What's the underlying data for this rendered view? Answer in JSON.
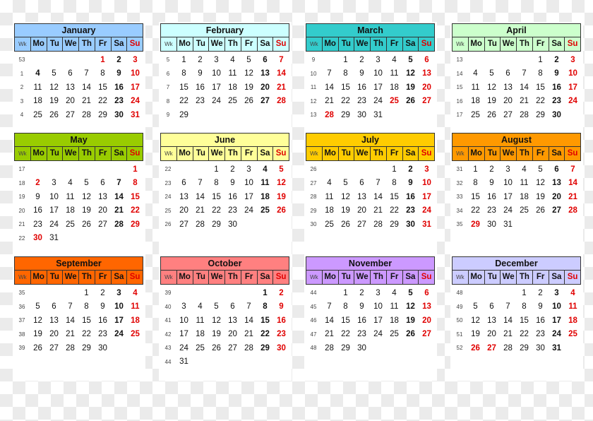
{
  "colors": {
    "holiday_red": "#e00000",
    "January": "#99ccff",
    "February": "#ccffff",
    "March": "#33cccc",
    "April": "#ccffcc",
    "May": "#99cc00",
    "June": "#ffff99",
    "July": "#ffcc00",
    "August": "#ff9900",
    "September": "#ff6600",
    "October": "#ff8080",
    "November": "#cc99ff",
    "December": "#ccccff"
  },
  "header_labels": [
    "Wk",
    "Mo",
    "Tu",
    "We",
    "Th",
    "Fr",
    "Sa",
    "Su"
  ],
  "months": [
    {
      "name": "January",
      "color_key": "January",
      "weeks": [
        {
          "wk": "53",
          "days": [
            "",
            "",
            "",
            "",
            "1",
            "2",
            "3"
          ]
        },
        {
          "wk": "1",
          "days": [
            "4",
            "5",
            "6",
            "7",
            "8",
            "9",
            "10"
          ]
        },
        {
          "wk": "2",
          "days": [
            "11",
            "12",
            "13",
            "14",
            "15",
            "16",
            "17"
          ]
        },
        {
          "wk": "3",
          "days": [
            "18",
            "19",
            "20",
            "21",
            "22",
            "23",
            "24"
          ]
        },
        {
          "wk": "4",
          "days": [
            "25",
            "26",
            "27",
            "28",
            "29",
            "30",
            "31"
          ]
        }
      ],
      "holidays": [
        "1"
      ],
      "bold_extra": [
        "4"
      ]
    },
    {
      "name": "February",
      "color_key": "February",
      "weeks": [
        {
          "wk": "5",
          "days": [
            "1",
            "2",
            "3",
            "4",
            "5",
            "6",
            "7"
          ]
        },
        {
          "wk": "6",
          "days": [
            "8",
            "9",
            "10",
            "11",
            "12",
            "13",
            "14"
          ]
        },
        {
          "wk": "7",
          "days": [
            "15",
            "16",
            "17",
            "18",
            "19",
            "20",
            "21"
          ]
        },
        {
          "wk": "8",
          "days": [
            "22",
            "23",
            "24",
            "25",
            "26",
            "27",
            "28"
          ]
        },
        {
          "wk": "9",
          "days": [
            "29",
            "",
            "",
            "",
            "",
            "",
            ""
          ]
        }
      ],
      "holidays": [],
      "bold_extra": []
    },
    {
      "name": "March",
      "color_key": "March",
      "weeks": [
        {
          "wk": "9",
          "days": [
            "",
            "1",
            "2",
            "3",
            "4",
            "5",
            "6"
          ]
        },
        {
          "wk": "10",
          "days": [
            "7",
            "8",
            "9",
            "10",
            "11",
            "12",
            "13"
          ]
        },
        {
          "wk": "11",
          "days": [
            "14",
            "15",
            "16",
            "17",
            "18",
            "19",
            "20"
          ]
        },
        {
          "wk": "12",
          "days": [
            "21",
            "22",
            "23",
            "24",
            "25",
            "26",
            "27"
          ]
        },
        {
          "wk": "13",
          "days": [
            "28",
            "29",
            "30",
            "31",
            "",
            "",
            ""
          ]
        }
      ],
      "holidays": [
        "25",
        "28"
      ],
      "bold_extra": []
    },
    {
      "name": "April",
      "color_key": "April",
      "weeks": [
        {
          "wk": "13",
          "days": [
            "",
            "",
            "",
            "",
            "1",
            "2",
            "3"
          ]
        },
        {
          "wk": "14",
          "days": [
            "4",
            "5",
            "6",
            "7",
            "8",
            "9",
            "10"
          ]
        },
        {
          "wk": "15",
          "days": [
            "11",
            "12",
            "13",
            "14",
            "15",
            "16",
            "17"
          ]
        },
        {
          "wk": "16",
          "days": [
            "18",
            "19",
            "20",
            "21",
            "22",
            "23",
            "24"
          ]
        },
        {
          "wk": "17",
          "days": [
            "25",
            "26",
            "27",
            "28",
            "29",
            "30",
            ""
          ]
        }
      ],
      "holidays": [],
      "bold_extra": []
    },
    {
      "name": "May",
      "color_key": "May",
      "weeks": [
        {
          "wk": "17",
          "days": [
            "",
            "",
            "",
            "",
            "",
            "",
            "1"
          ]
        },
        {
          "wk": "18",
          "days": [
            "2",
            "3",
            "4",
            "5",
            "6",
            "7",
            "8"
          ]
        },
        {
          "wk": "19",
          "days": [
            "9",
            "10",
            "11",
            "12",
            "13",
            "14",
            "15"
          ]
        },
        {
          "wk": "20",
          "days": [
            "16",
            "17",
            "18",
            "19",
            "20",
            "21",
            "22"
          ]
        },
        {
          "wk": "21",
          "days": [
            "23",
            "24",
            "25",
            "26",
            "27",
            "28",
            "29"
          ]
        },
        {
          "wk": "22",
          "days": [
            "30",
            "31",
            "",
            "",
            "",
            "",
            ""
          ]
        }
      ],
      "holidays": [
        "2",
        "30"
      ],
      "bold_extra": []
    },
    {
      "name": "June",
      "color_key": "June",
      "weeks": [
        {
          "wk": "22",
          "days": [
            "",
            "",
            "1",
            "2",
            "3",
            "4",
            "5"
          ]
        },
        {
          "wk": "23",
          "days": [
            "6",
            "7",
            "8",
            "9",
            "10",
            "11",
            "12"
          ]
        },
        {
          "wk": "24",
          "days": [
            "13",
            "14",
            "15",
            "16",
            "17",
            "18",
            "19"
          ]
        },
        {
          "wk": "25",
          "days": [
            "20",
            "21",
            "22",
            "23",
            "24",
            "25",
            "26"
          ]
        },
        {
          "wk": "26",
          "days": [
            "27",
            "28",
            "29",
            "30",
            "",
            "",
            ""
          ]
        }
      ],
      "holidays": [],
      "bold_extra": []
    },
    {
      "name": "July",
      "color_key": "July",
      "weeks": [
        {
          "wk": "26",
          "days": [
            "",
            "",
            "",
            "",
            "1",
            "2",
            "3"
          ]
        },
        {
          "wk": "27",
          "days": [
            "4",
            "5",
            "6",
            "7",
            "8",
            "9",
            "10"
          ]
        },
        {
          "wk": "28",
          "days": [
            "11",
            "12",
            "13",
            "14",
            "15",
            "16",
            "17"
          ]
        },
        {
          "wk": "29",
          "days": [
            "18",
            "19",
            "20",
            "21",
            "22",
            "23",
            "24"
          ]
        },
        {
          "wk": "30",
          "days": [
            "25",
            "26",
            "27",
            "28",
            "29",
            "30",
            "31"
          ]
        }
      ],
      "holidays": [],
      "bold_extra": []
    },
    {
      "name": "August",
      "color_key": "August",
      "weeks": [
        {
          "wk": "31",
          "days": [
            "1",
            "2",
            "3",
            "4",
            "5",
            "6",
            "7"
          ]
        },
        {
          "wk": "32",
          "days": [
            "8",
            "9",
            "10",
            "11",
            "12",
            "13",
            "14"
          ]
        },
        {
          "wk": "33",
          "days": [
            "15",
            "16",
            "17",
            "18",
            "19",
            "20",
            "21"
          ]
        },
        {
          "wk": "34",
          "days": [
            "22",
            "23",
            "24",
            "25",
            "26",
            "27",
            "28"
          ]
        },
        {
          "wk": "35",
          "days": [
            "29",
            "30",
            "31",
            "",
            "",
            "",
            ""
          ]
        }
      ],
      "holidays": [
        "29"
      ],
      "bold_extra": []
    },
    {
      "name": "September",
      "color_key": "September",
      "weeks": [
        {
          "wk": "35",
          "days": [
            "",
            "",
            "",
            "1",
            "2",
            "3",
            "4"
          ]
        },
        {
          "wk": "36",
          "days": [
            "5",
            "6",
            "7",
            "8",
            "9",
            "10",
            "11"
          ]
        },
        {
          "wk": "37",
          "days": [
            "12",
            "13",
            "14",
            "15",
            "16",
            "17",
            "18"
          ]
        },
        {
          "wk": "38",
          "days": [
            "19",
            "20",
            "21",
            "22",
            "23",
            "24",
            "25"
          ]
        },
        {
          "wk": "39",
          "days": [
            "26",
            "27",
            "28",
            "29",
            "30",
            "",
            ""
          ]
        }
      ],
      "holidays": [],
      "bold_extra": []
    },
    {
      "name": "October",
      "color_key": "October",
      "weeks": [
        {
          "wk": "39",
          "days": [
            "",
            "",
            "",
            "",
            "",
            "1",
            "2"
          ]
        },
        {
          "wk": "40",
          "days": [
            "3",
            "4",
            "5",
            "6",
            "7",
            "8",
            "9"
          ]
        },
        {
          "wk": "41",
          "days": [
            "10",
            "11",
            "12",
            "13",
            "14",
            "15",
            "16"
          ]
        },
        {
          "wk": "42",
          "days": [
            "17",
            "18",
            "19",
            "20",
            "21",
            "22",
            "23"
          ]
        },
        {
          "wk": "43",
          "days": [
            "24",
            "25",
            "26",
            "27",
            "28",
            "29",
            "30"
          ]
        },
        {
          "wk": "44",
          "days": [
            "31",
            "",
            "",
            "",
            "",
            "",
            ""
          ]
        }
      ],
      "holidays": [],
      "bold_extra": []
    },
    {
      "name": "November",
      "color_key": "November",
      "weeks": [
        {
          "wk": "44",
          "days": [
            "",
            "1",
            "2",
            "3",
            "4",
            "5",
            "6"
          ]
        },
        {
          "wk": "45",
          "days": [
            "7",
            "8",
            "9",
            "10",
            "11",
            "12",
            "13"
          ]
        },
        {
          "wk": "46",
          "days": [
            "14",
            "15",
            "16",
            "17",
            "18",
            "19",
            "20"
          ]
        },
        {
          "wk": "47",
          "days": [
            "21",
            "22",
            "23",
            "24",
            "25",
            "26",
            "27"
          ]
        },
        {
          "wk": "48",
          "days": [
            "28",
            "29",
            "30",
            "",
            "",
            "",
            ""
          ]
        }
      ],
      "holidays": [],
      "bold_extra": []
    },
    {
      "name": "December",
      "color_key": "December",
      "weeks": [
        {
          "wk": "48",
          "days": [
            "",
            "",
            "",
            "1",
            "2",
            "3",
            "4"
          ]
        },
        {
          "wk": "49",
          "days": [
            "5",
            "6",
            "7",
            "8",
            "9",
            "10",
            "11"
          ]
        },
        {
          "wk": "50",
          "days": [
            "12",
            "13",
            "14",
            "15",
            "16",
            "17",
            "18"
          ]
        },
        {
          "wk": "51",
          "days": [
            "19",
            "20",
            "21",
            "22",
            "23",
            "24",
            "25"
          ]
        },
        {
          "wk": "52",
          "days": [
            "26",
            "27",
            "28",
            "29",
            "30",
            "31",
            ""
          ]
        }
      ],
      "holidays": [
        "26",
        "27"
      ],
      "bold_extra": []
    }
  ]
}
